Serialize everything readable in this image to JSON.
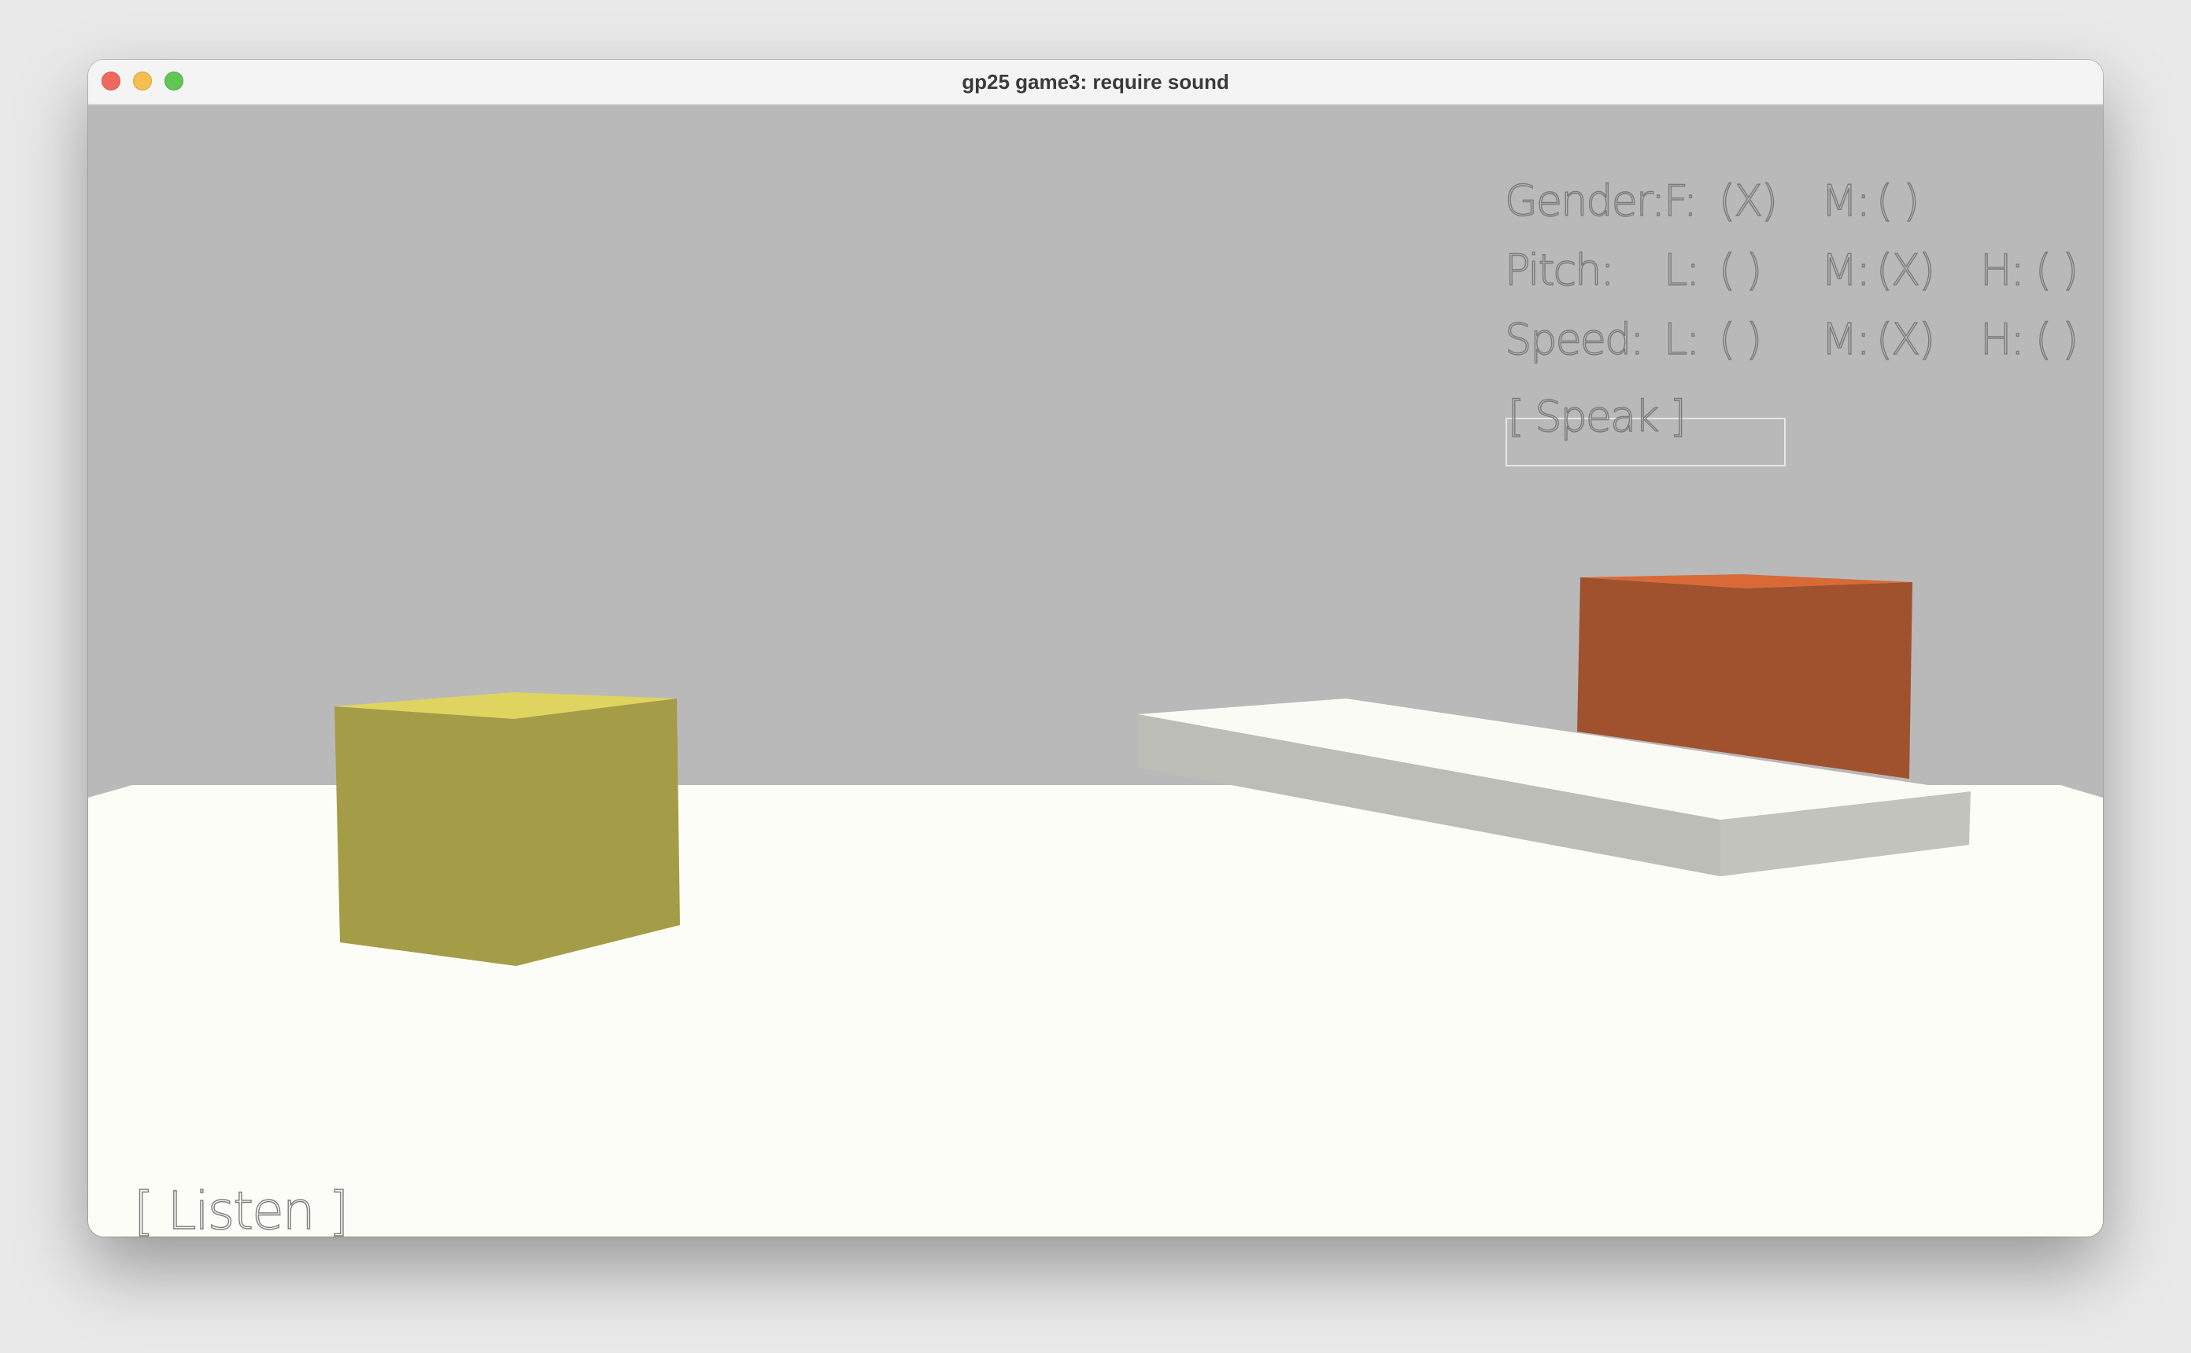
{
  "window": {
    "title": "gp25 game3: require sound"
  },
  "colors": {
    "sky": "#b9b9b9",
    "floor": "#fdfdf8",
    "yellow_cube_front": "#a59c47",
    "yellow_cube_top": "#e0d460",
    "orange_box_front": "#a0512e",
    "orange_box_top": "#d96a38",
    "platform_top": "#fbfbf6",
    "platform_side": "#bcbdb7",
    "hud_text": "#7b7b7b"
  },
  "hud": {
    "gender": {
      "label": "Gender:",
      "options": [
        {
          "key": "F:",
          "mark": "(X)",
          "selected": true
        },
        {
          "key": "M:",
          "mark": "( )",
          "selected": false
        }
      ]
    },
    "pitch": {
      "label": "Pitch:",
      "options": [
        {
          "key": "L:",
          "mark": "( )",
          "selected": false
        },
        {
          "key": "M:",
          "mark": "(X)",
          "selected": true
        },
        {
          "key": "H:",
          "mark": "( )",
          "selected": false
        }
      ]
    },
    "speed": {
      "label": "Speed:",
      "options": [
        {
          "key": "L:",
          "mark": "( )",
          "selected": false
        },
        {
          "key": "M:",
          "mark": "(X)",
          "selected": true
        },
        {
          "key": "H:",
          "mark": "( )",
          "selected": false
        }
      ]
    },
    "speak_button": "[ Speak ]",
    "listen_button": "[ Listen ]"
  }
}
